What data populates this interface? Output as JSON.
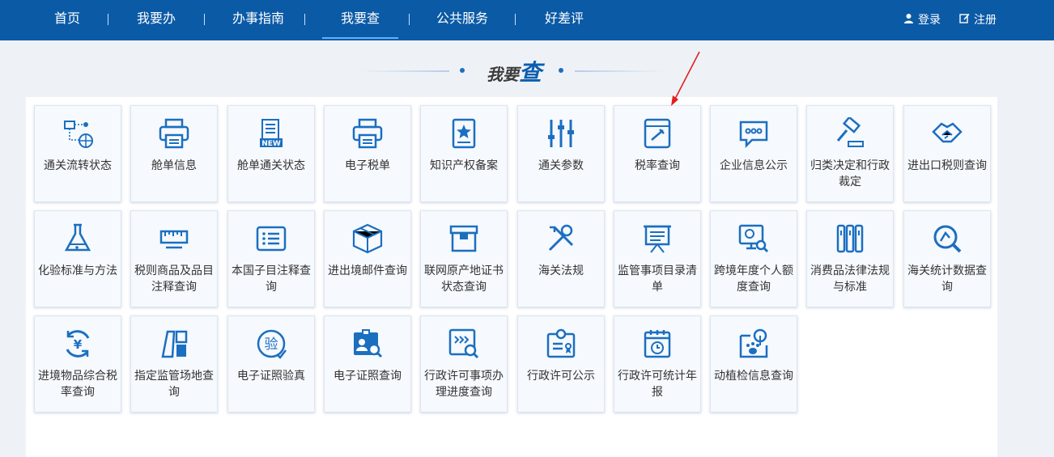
{
  "nav": {
    "items": [
      {
        "label": "首页"
      },
      {
        "label": "我要办"
      },
      {
        "label": "办事指南"
      },
      {
        "label": "我要查"
      },
      {
        "label": "公共服务"
      },
      {
        "label": "好差评"
      }
    ],
    "active_index": 3,
    "login_label": "登录",
    "register_label": "注册"
  },
  "section": {
    "title_prefix": "我要",
    "title_main": "查"
  },
  "colors": {
    "nav_bg": "#0b5aa6",
    "icon_blue": "#1b6fc0",
    "page_bg": "#eef2f7"
  },
  "tiles": [
    {
      "label": "通关流转状态",
      "icon": "network-icon"
    },
    {
      "label": "舱单信息",
      "icon": "printer-icon"
    },
    {
      "label": "舱单通关状态",
      "icon": "new-document-icon"
    },
    {
      "label": "电子税单",
      "icon": "printer-icon"
    },
    {
      "label": "知识产权备案",
      "icon": "star-certificate-icon"
    },
    {
      "label": "通关参数",
      "icon": "sliders-icon"
    },
    {
      "label": "税率查询",
      "icon": "tax-book-icon"
    },
    {
      "label": "企业信息公示",
      "icon": "chat-bubble-icon"
    },
    {
      "label": "归类决定和行政裁定",
      "icon": "gavel-icon"
    },
    {
      "label": "进出口税则查询",
      "icon": "handshake-icon"
    },
    {
      "label": "化验标准与方法",
      "icon": "flask-icon"
    },
    {
      "label": "税则商品及品目注释查询",
      "icon": "ruler-icon"
    },
    {
      "label": "本国子目注释查询",
      "icon": "list-card-icon"
    },
    {
      "label": "进出境邮件查询",
      "icon": "parcel-box-icon"
    },
    {
      "label": "联网原产地证书状态查询",
      "icon": "archive-box-icon"
    },
    {
      "label": "海关法规",
      "icon": "tools-icon"
    },
    {
      "label": "监管事项目录清单",
      "icon": "easel-board-icon"
    },
    {
      "label": "跨境年度个人额度查询",
      "icon": "monitor-search-icon"
    },
    {
      "label": "消费品法律法规与标准",
      "icon": "books-icon"
    },
    {
      "label": "海关统计数据查询",
      "icon": "search-stats-icon"
    },
    {
      "label": "进境物品综合税率查询",
      "icon": "yuan-cycle-icon"
    },
    {
      "label": "指定监管场地查询",
      "icon": "site-blocks-icon"
    },
    {
      "label": "电子证照验真",
      "icon": "verify-badge-icon"
    },
    {
      "label": "电子证照查询",
      "icon": "id-card-search-icon"
    },
    {
      "label": "行政许可事项办理进度查询",
      "icon": "progress-search-icon"
    },
    {
      "label": "行政许可公示",
      "icon": "license-certificate-icon"
    },
    {
      "label": "行政许可统计年报",
      "icon": "calendar-clock-icon"
    },
    {
      "label": "动植检信息查询",
      "icon": "paw-plant-icon"
    }
  ]
}
